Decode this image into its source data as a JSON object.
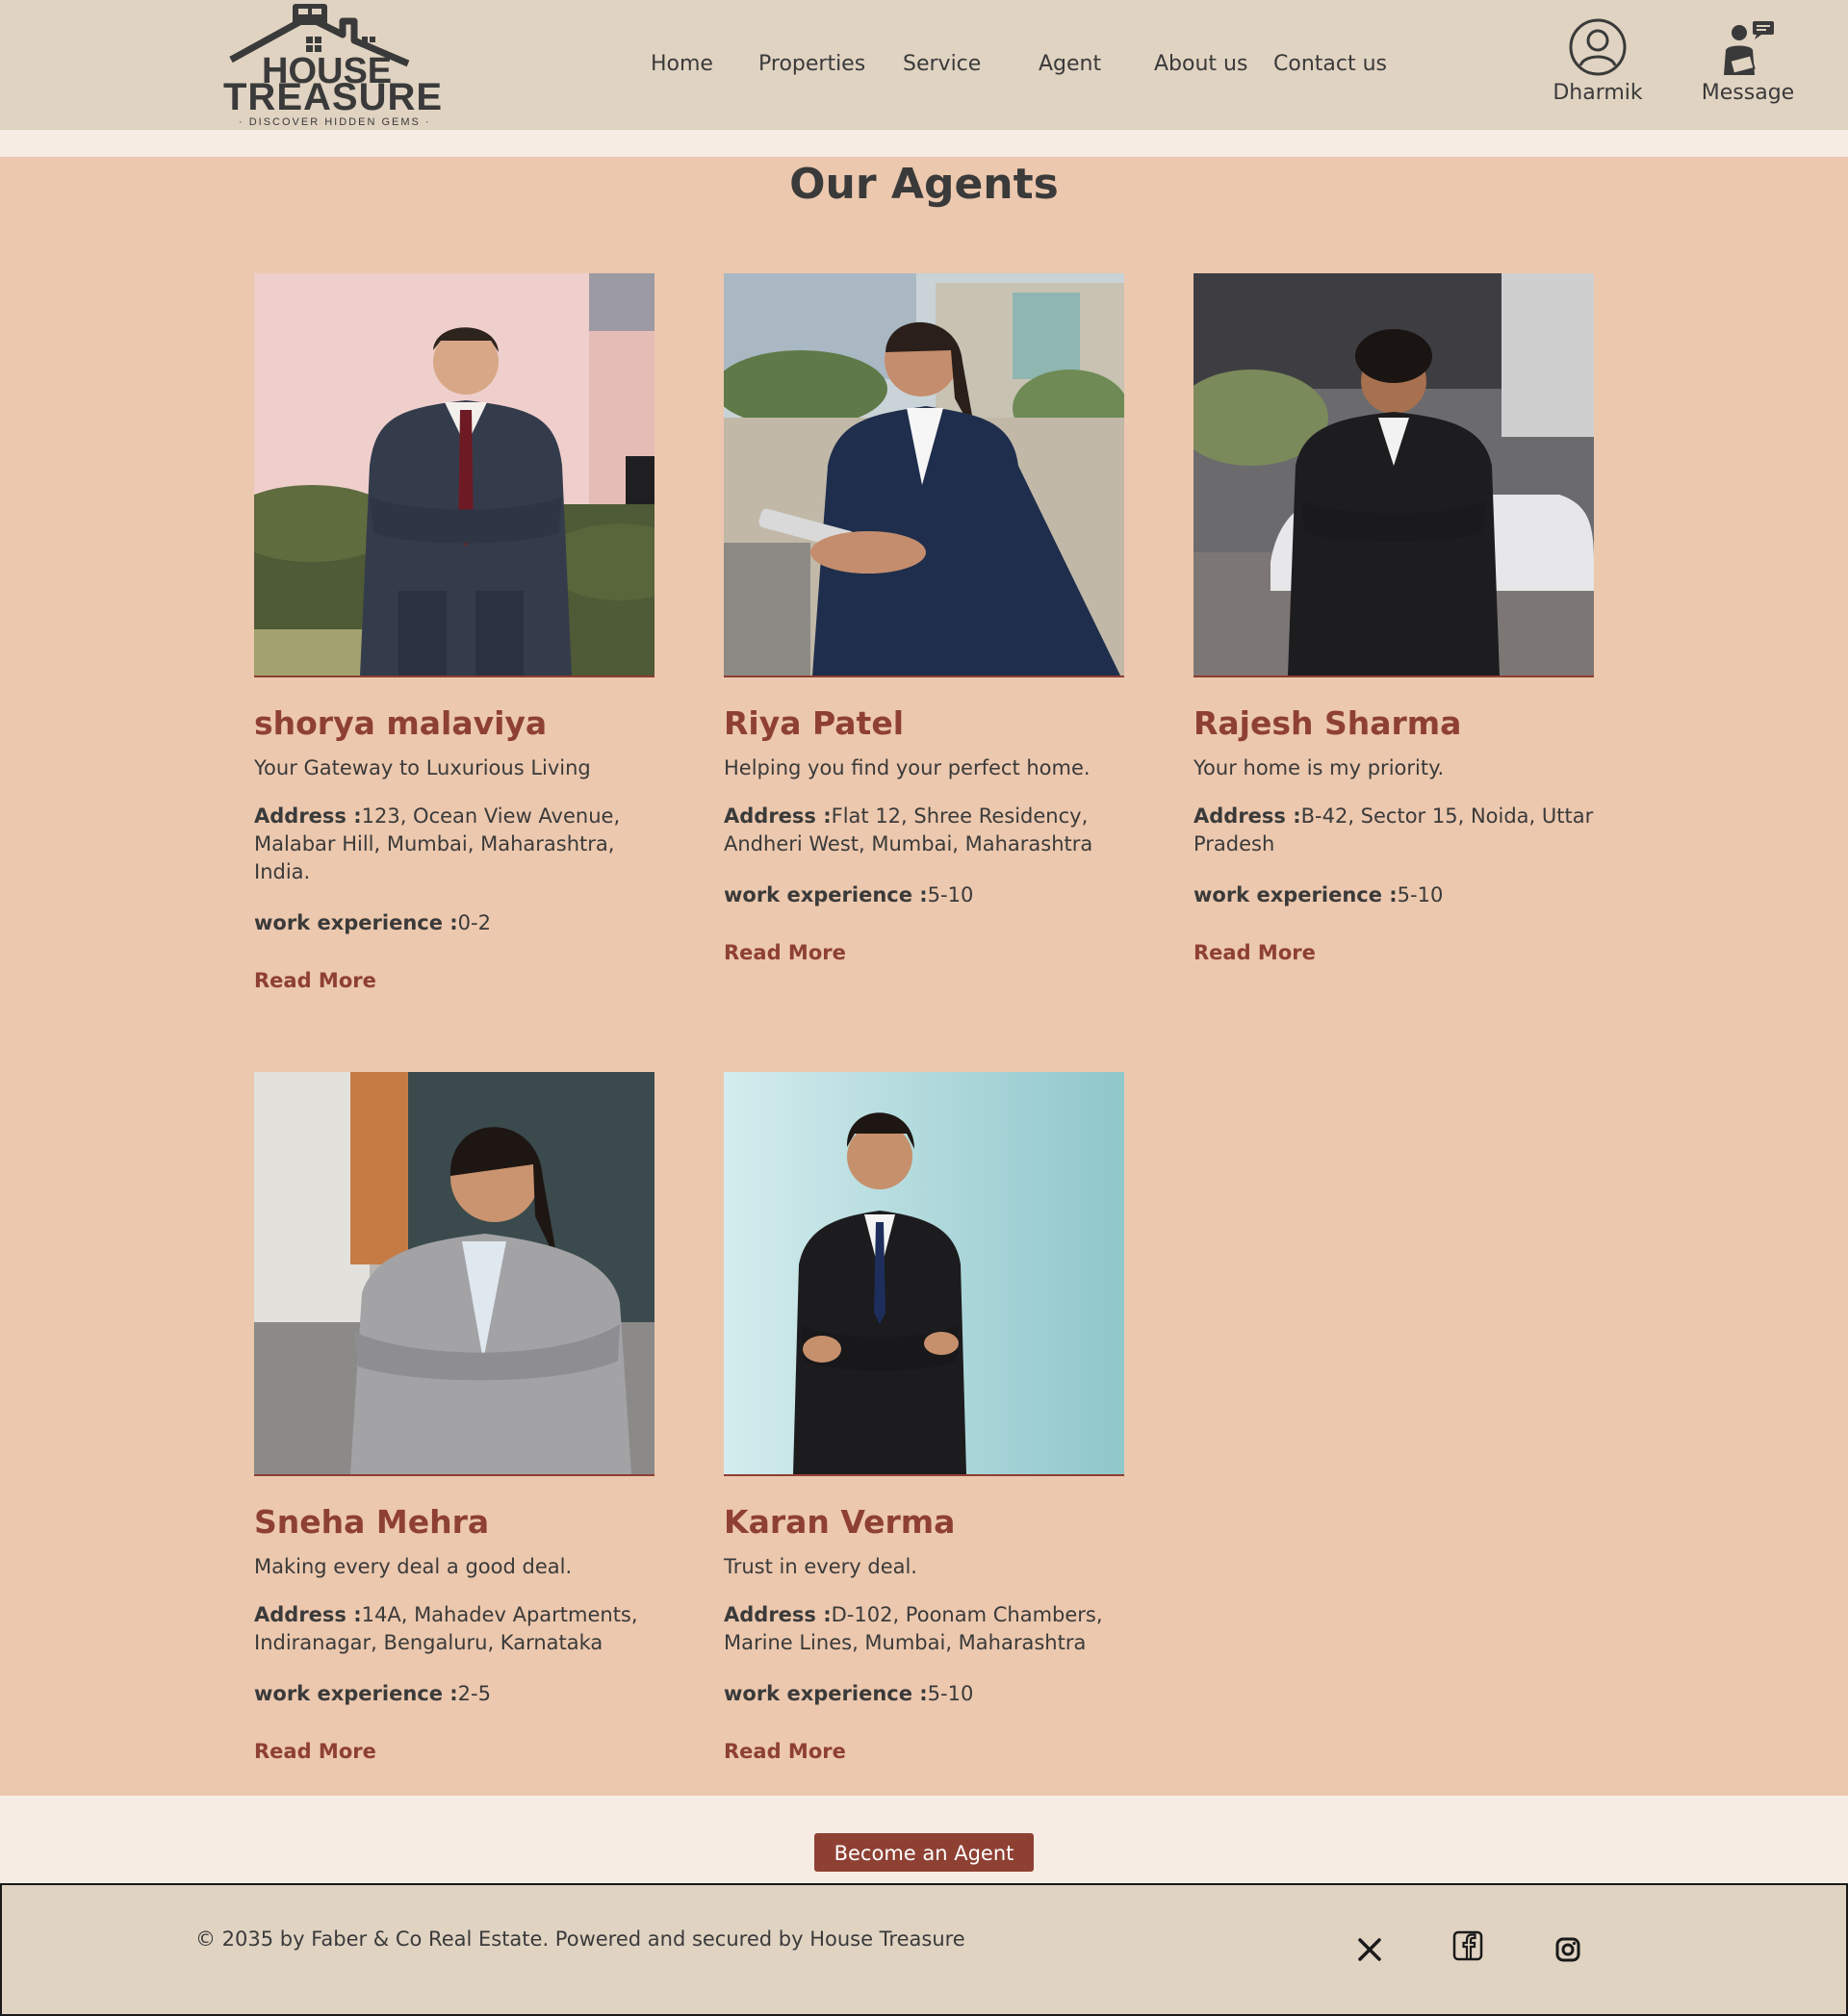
{
  "header": {
    "logo": {
      "line1": "HOUSE",
      "line2": "TREASURE",
      "tagline": "· DISCOVER HIDDEN GEMS ·"
    },
    "nav": [
      {
        "label": "Home"
      },
      {
        "label": "Properties"
      },
      {
        "label": "Service"
      },
      {
        "label": "Agent"
      },
      {
        "label": "About us"
      },
      {
        "label": "Contact us"
      }
    ],
    "user": {
      "label": "Dharmik",
      "icon": "user-circle-icon"
    },
    "message": {
      "label": "Message",
      "icon": "agent-message-icon"
    }
  },
  "page_title": "Our Agents",
  "labels": {
    "address": "Address :",
    "experience": "work experience :",
    "read_more": "Read More"
  },
  "agents": [
    {
      "name": "shorya malaviya",
      "tagline": "Your Gateway to Luxurious Living",
      "address": "123, Ocean View Avenue, Malabar Hill, Mumbai, Maharashtra, India.",
      "experience": "0-2"
    },
    {
      "name": "Riya Patel",
      "tagline": "Helping you find your perfect home.",
      "address": "Flat 12, Shree Residency, Andheri West, Mumbai, Maharashtra",
      "experience": "5-10"
    },
    {
      "name": "Rajesh Sharma",
      "tagline": "Your home is my priority.",
      "address": "B-42, Sector 15, Noida, Uttar Pradesh",
      "experience": "5-10"
    },
    {
      "name": "Sneha Mehra",
      "tagline": "Making every deal a good deal.",
      "address": "14A, Mahadev Apartments, Indiranagar, Bengaluru, Karnataka",
      "experience": "2-5"
    },
    {
      "name": "Karan Verma",
      "tagline": "Trust in every deal.",
      "address": "D-102, Poonam Chambers, Marine Lines, Mumbai, Maharashtra",
      "experience": "5-10"
    }
  ],
  "become_agent": "Become an Agent",
  "footer": {
    "copyright": "© 2035 by Faber & Co Real Estate. Powered and secured by House Treasure",
    "social": [
      "x-icon",
      "facebook-icon",
      "instagram-icon"
    ]
  },
  "colors": {
    "header_bg": "#e0d3c2",
    "band_bg": "#ecc8ae",
    "accent": "#8e4033",
    "text": "#3a3a3a"
  }
}
